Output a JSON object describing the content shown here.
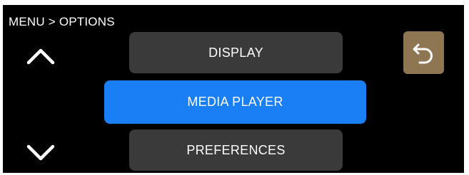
{
  "header": {
    "breadcrumb": "MENU > OPTIONS"
  },
  "menu": {
    "items": [
      {
        "label": "DISPLAY",
        "selected": false
      },
      {
        "label": "MEDIA PLAYER",
        "selected": true
      },
      {
        "label": "PREFERENCES",
        "selected": false
      }
    ]
  },
  "controls": {
    "up_icon": "chevron-up-icon",
    "down_icon": "chevron-down-icon",
    "back_icon": "back-arrow-icon"
  },
  "colors": {
    "background": "#000000",
    "button": "#3a3a3a",
    "selected": "#1a7ef5",
    "back_button": "#8f7653",
    "text": "#ffffff"
  }
}
